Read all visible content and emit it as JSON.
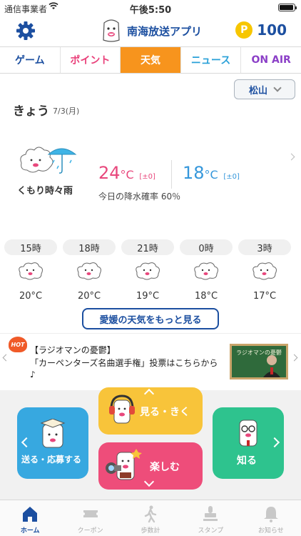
{
  "status_bar": {
    "carrier": "通信事業者",
    "time": "午後5:50"
  },
  "header": {
    "app_title": "南海放送アプリ",
    "points": "100",
    "point_symbol": "P"
  },
  "tabs": [
    {
      "label": "ゲーム",
      "active": false
    },
    {
      "label": "ポイント",
      "active": false
    },
    {
      "label": "天気",
      "active": true
    },
    {
      "label": "ニュース",
      "active": false
    },
    {
      "label": "ON AIR",
      "active": false
    }
  ],
  "weather": {
    "region": "松山",
    "today_label": "きょう",
    "today_date": "7/3(月)",
    "condition": "くもり時々雨",
    "high_temp": "24",
    "high_unit": "°C",
    "high_diff": "[±0]",
    "low_temp": "18",
    "low_unit": "°C",
    "low_diff": "[±0]",
    "precip": "今日の降水確率 60％",
    "hourly": [
      {
        "time": "15時",
        "temp": "20°C",
        "icon": "cloudy-icon"
      },
      {
        "time": "18時",
        "temp": "20°C",
        "icon": "cloudy-icon"
      },
      {
        "time": "21時",
        "temp": "19°C",
        "icon": "cloudy-icon"
      },
      {
        "time": "0時",
        "temp": "18°C",
        "icon": "cloudy-icon"
      },
      {
        "time": "3時",
        "temp": "17°C",
        "icon": "cloudy-icon"
      }
    ],
    "more_button": "愛媛の天気をもっと見る"
  },
  "banner": {
    "hot": "HOT",
    "line1": "【ラジオマンの憂鬱】",
    "line2": "「カーペンターズ名曲選手権」投票はこちらから",
    "line3": "♪",
    "thumb_text": "ラジオマンの憂鬱"
  },
  "menu": {
    "listen": "見る・きく",
    "send": "送る・応募する",
    "know": "知る",
    "enjoy": "楽しむ"
  },
  "tabbar": [
    {
      "label": "ホーム",
      "icon": "home-icon",
      "active": true
    },
    {
      "label": "クーポン",
      "icon": "coupon-icon",
      "active": false
    },
    {
      "label": "歩数計",
      "icon": "pedometer-icon",
      "active": false
    },
    {
      "label": "スタンプ",
      "icon": "stamp-icon",
      "active": false
    },
    {
      "label": "お知らせ",
      "icon": "bell-icon",
      "active": false
    }
  ],
  "colors": {
    "brand_blue": "#1c4fa0",
    "tab_active": "#f7941d",
    "high_temp": "#e8477c",
    "low_temp": "#3597db",
    "tile_send": "#37a8e0",
    "tile_listen": "#f8c43a",
    "tile_enjoy": "#ee4d7a",
    "tile_know": "#2ec38e"
  }
}
